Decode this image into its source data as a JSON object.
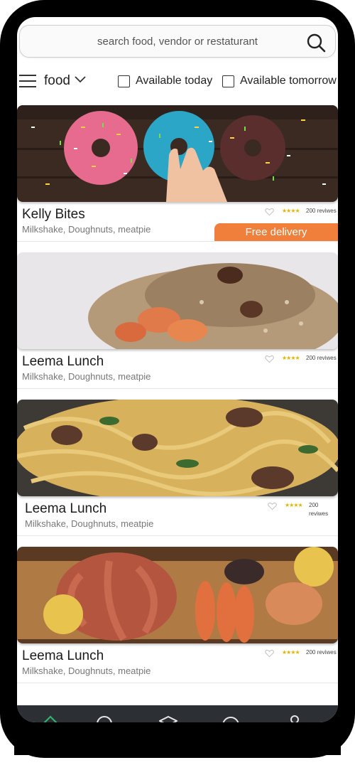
{
  "search": {
    "placeholder": "search food, vendor or restaturant",
    "icon": "search-icon"
  },
  "filters": {
    "category": "food",
    "options": [
      {
        "label": "Available today",
        "checked": false
      },
      {
        "label": "Available tomorrow",
        "checked": false
      }
    ]
  },
  "vendors": [
    {
      "name": "Kelly Bites",
      "tags": "Milkshake, Doughnuts, meatpie",
      "rating_stars": "★★★★",
      "reviews": "200 reviwes",
      "badge": "Free delivery",
      "image": "doughnuts"
    },
    {
      "name": "Leema Lunch",
      "tags": "Milkshake, Doughnuts, meatpie",
      "rating_stars": "★★★★",
      "reviews": "200 reviwes",
      "image": "fried-rice-shrimp"
    },
    {
      "name": "Leema Lunch",
      "tags": "Milkshake, Doughnuts, meatpie",
      "rating_stars": "★★★★",
      "reviews": "200 reviwes",
      "image": "pasta"
    },
    {
      "name": "Leema Lunch",
      "tags": "Milkshake, Doughnuts, meatpie",
      "rating_stars": "★★★★",
      "reviews": "200 reviwes",
      "image": "seafood-platter"
    }
  ],
  "bottom_nav": {
    "items": [
      "home-icon",
      "search-icon",
      "box-icon",
      "chat-icon",
      "profile-icon"
    ],
    "active_color": "#2fb36b"
  },
  "colors": {
    "accent": "#f07f3c",
    "star": "#e3b400"
  }
}
